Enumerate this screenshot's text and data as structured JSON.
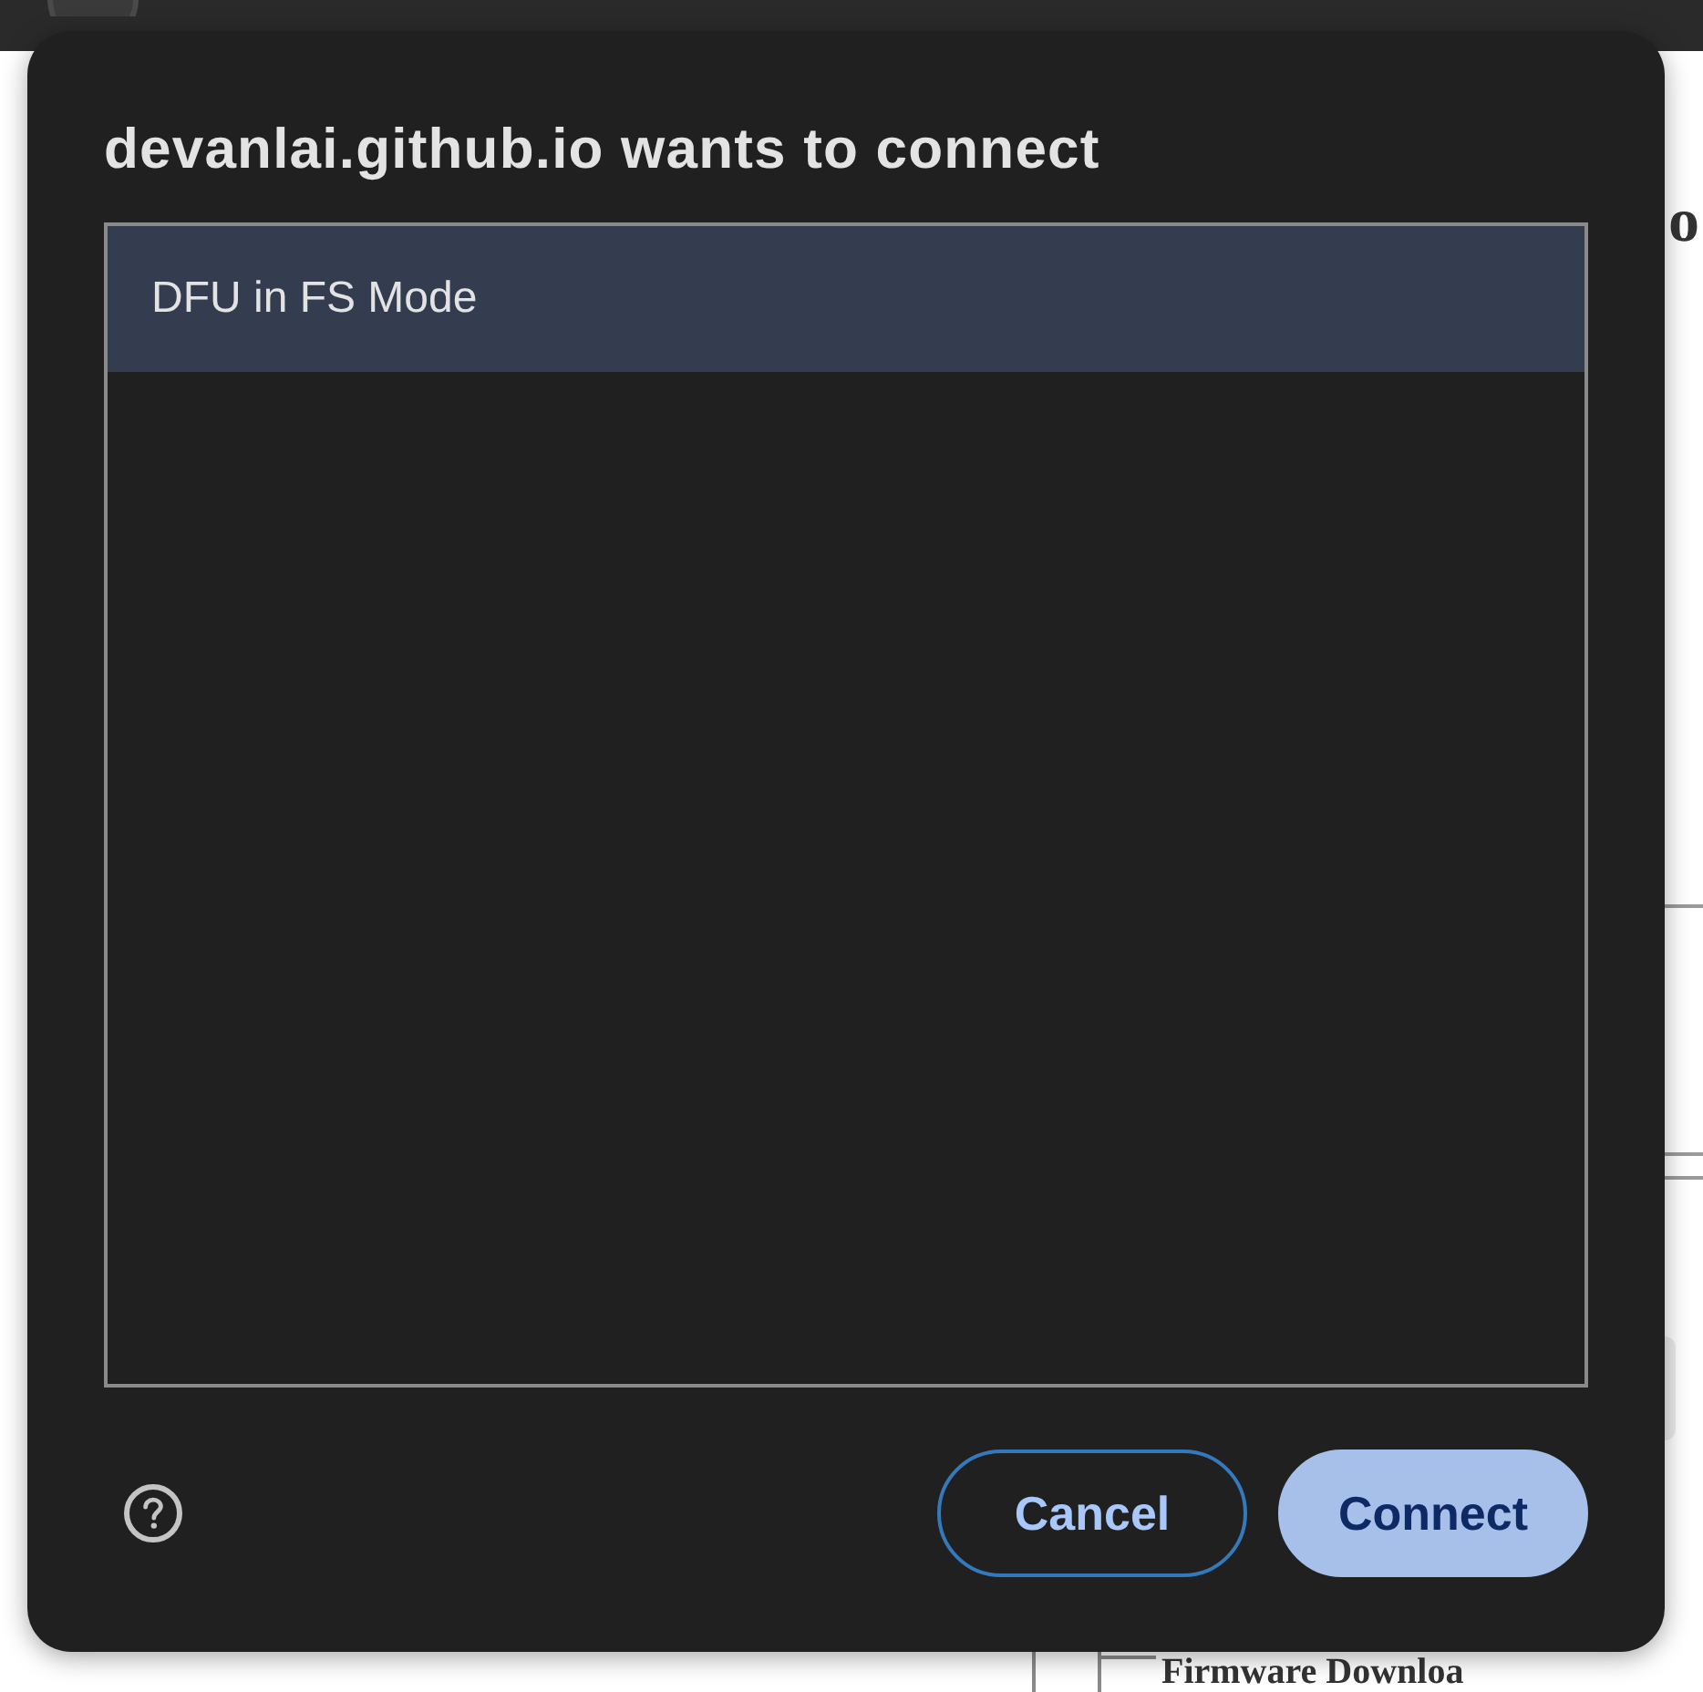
{
  "background_page": {
    "heading_fragment": "o",
    "legend": "Firmware Downloa"
  },
  "dialog": {
    "title": "devanlai.github.io wants to connect",
    "devices": [
      {
        "name": "DFU in FS Mode",
        "selected": true
      }
    ],
    "buttons": [
      {
        "label": "Cancel",
        "kind": "secondary"
      },
      {
        "label": "Connect",
        "kind": "primary"
      }
    ]
  }
}
